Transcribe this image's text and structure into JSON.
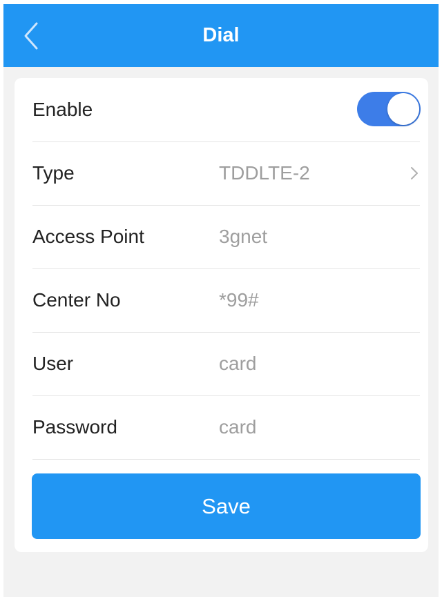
{
  "header": {
    "title": "Dial",
    "back_icon": "chevron-left-icon",
    "background_color": "#2196f3"
  },
  "form": {
    "enable": {
      "label": "Enable",
      "value": true,
      "toggle_color": "#3d7de8"
    },
    "type": {
      "label": "Type",
      "value": "TDDLTE-2",
      "icon": "chevron-right-icon"
    },
    "access_point": {
      "label": "Access Point",
      "value": "3gnet"
    },
    "center_no": {
      "label": "Center No",
      "value": "*99#"
    },
    "user": {
      "label": "User",
      "value": "card"
    },
    "password": {
      "label": "Password",
      "value": "card"
    }
  },
  "save": {
    "label": "Save",
    "color": "#2196f3"
  }
}
